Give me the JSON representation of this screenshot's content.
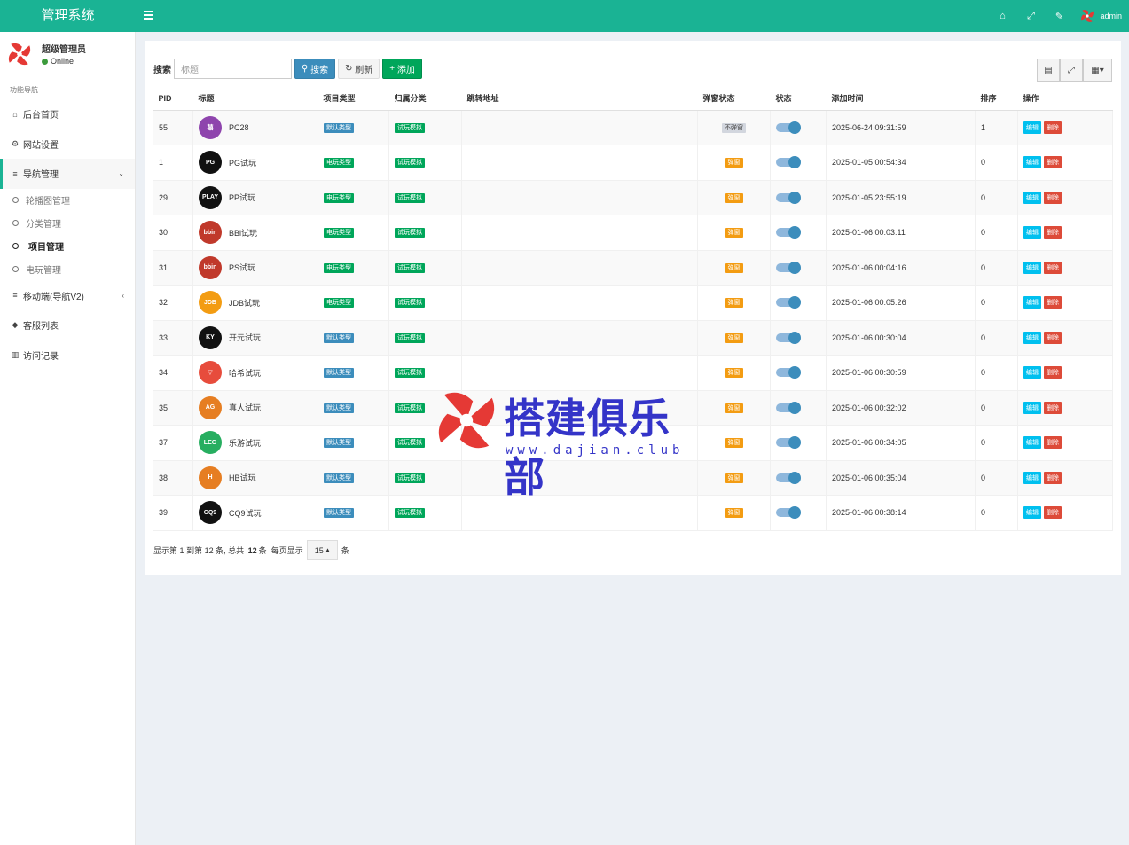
{
  "header": {
    "title": "管理系统",
    "user": "admin"
  },
  "sidebar": {
    "user_name": "超级管理员",
    "status": "Online",
    "nav_title": "功能导航",
    "items": [
      {
        "label": "后台首页",
        "icon": "home-icon"
      },
      {
        "label": "网站设置",
        "icon": "cogs-icon"
      },
      {
        "label": "导航管理",
        "icon": "list-icon",
        "expanded": true
      },
      {
        "label": "移动端(导航V2)",
        "icon": "list-icon"
      },
      {
        "label": "客服列表",
        "icon": "tag-icon"
      },
      {
        "label": "访问记录",
        "icon": "bar-chart-icon"
      }
    ],
    "sub_items": [
      {
        "label": "轮播图管理"
      },
      {
        "label": "分类管理"
      },
      {
        "label": "项目管理",
        "active": true
      },
      {
        "label": "电玩管理"
      }
    ]
  },
  "toolbar": {
    "search_label": "搜索",
    "search_placeholder": "标题",
    "search_btn": "搜索",
    "refresh_btn": "刷新",
    "add_btn": "添加"
  },
  "table": {
    "headers": [
      "PID",
      "标题",
      "项目类型",
      "归属分类",
      "跳转地址",
      "弹窗状态",
      "状态",
      "添加时间",
      "排序",
      "操作"
    ],
    "rows": [
      {
        "pid": "55",
        "title": "PC28",
        "logo": "囍",
        "logo_color": "#8e44ad",
        "type": "默认类型",
        "type_color": "blue",
        "cat": "试玩模拟",
        "popup": "不弹窗",
        "popup_color": "gray",
        "time": "2025-06-24 09:31:59",
        "sort": "1"
      },
      {
        "pid": "1",
        "title": "PG试玩",
        "logo": "PG",
        "logo_color": "#111111",
        "type": "电玩类型",
        "type_color": "green",
        "cat": "试玩模拟",
        "popup": "弹窗",
        "popup_color": "orange",
        "time": "2025-01-05 00:54:34",
        "sort": "0"
      },
      {
        "pid": "29",
        "title": "PP试玩",
        "logo": "PLAY",
        "logo_color": "#111111",
        "type": "电玩类型",
        "type_color": "green",
        "cat": "试玩模拟",
        "popup": "弹窗",
        "popup_color": "orange",
        "time": "2025-01-05 23:55:19",
        "sort": "0"
      },
      {
        "pid": "30",
        "title": "BBi试玩",
        "logo": "bbin",
        "logo_color": "#c0392b",
        "type": "电玩类型",
        "type_color": "green",
        "cat": "试玩模拟",
        "popup": "弹窗",
        "popup_color": "orange",
        "time": "2025-01-06 00:03:11",
        "sort": "0"
      },
      {
        "pid": "31",
        "title": "PS试玩",
        "logo": "bbin",
        "logo_color": "#c0392b",
        "type": "电玩类型",
        "type_color": "green",
        "cat": "试玩模拟",
        "popup": "弹窗",
        "popup_color": "orange",
        "time": "2025-01-06 00:04:16",
        "sort": "0"
      },
      {
        "pid": "32",
        "title": "JDB试玩",
        "logo": "JDB",
        "logo_color": "#f39c12",
        "type": "电玩类型",
        "type_color": "green",
        "cat": "试玩模拟",
        "popup": "弹窗",
        "popup_color": "orange",
        "time": "2025-01-06 00:05:26",
        "sort": "0"
      },
      {
        "pid": "33",
        "title": "开元试玩",
        "logo": "KY",
        "logo_color": "#111111",
        "type": "默认类型",
        "type_color": "blue",
        "cat": "试玩模拟",
        "popup": "弹窗",
        "popup_color": "orange",
        "time": "2025-01-06 00:30:04",
        "sort": "0"
      },
      {
        "pid": "34",
        "title": "哈希试玩",
        "logo": "▽",
        "logo_color": "#e74c3c",
        "type": "默认类型",
        "type_color": "blue",
        "cat": "试玩模拟",
        "popup": "弹窗",
        "popup_color": "orange",
        "time": "2025-01-06 00:30:59",
        "sort": "0"
      },
      {
        "pid": "35",
        "title": "真人试玩",
        "logo": "AG",
        "logo_color": "#e67e22",
        "type": "默认类型",
        "type_color": "blue",
        "cat": "试玩模拟",
        "popup": "弹窗",
        "popup_color": "orange",
        "time": "2025-01-06 00:32:02",
        "sort": "0"
      },
      {
        "pid": "37",
        "title": "乐游试玩",
        "logo": "LEG",
        "logo_color": "#27ae60",
        "type": "默认类型",
        "type_color": "blue",
        "cat": "试玩模拟",
        "popup": "弹窗",
        "popup_color": "orange",
        "time": "2025-01-06 00:34:05",
        "sort": "0"
      },
      {
        "pid": "38",
        "title": "HB试玩",
        "logo": "H",
        "logo_color": "#e67e22",
        "type": "默认类型",
        "type_color": "blue",
        "cat": "试玩模拟",
        "popup": "弹窗",
        "popup_color": "orange",
        "time": "2025-01-06 00:35:04",
        "sort": "0"
      },
      {
        "pid": "39",
        "title": "CQ9试玩",
        "logo": "CQ9",
        "logo_color": "#111111",
        "type": "默认类型",
        "type_color": "blue",
        "cat": "试玩模拟",
        "popup": "弹窗",
        "popup_color": "orange",
        "time": "2025-01-06 00:38:14",
        "sort": "0"
      }
    ],
    "edit_label": "编辑",
    "delete_label": "删除"
  },
  "footer": {
    "text1": "显示第",
    "from": "1",
    "text2": "到第",
    "to": "12",
    "text3": "条, 总共",
    "total": "12",
    "text4": "条",
    "per_page_label": "每页显示",
    "per_page": "15",
    "suffix": "条"
  },
  "watermark": {
    "title": "搭建俱乐部",
    "url": "www.dajian.club"
  },
  "colors": {
    "brand": "#1ab394",
    "primary": "#3c8dbc",
    "success": "#00a65a",
    "warning": "#f39c12",
    "danger": "#dd4b39",
    "info": "#00c0ef"
  }
}
